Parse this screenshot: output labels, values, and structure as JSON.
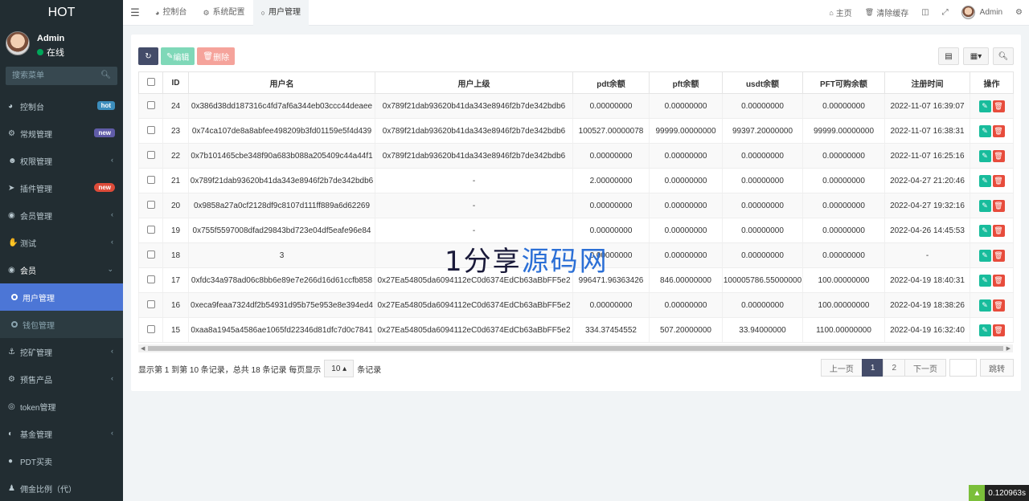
{
  "sidebar": {
    "logo": "HOT",
    "user": {
      "name": "Admin",
      "status": "在线"
    },
    "search_placeholder": "搜索菜单",
    "items": [
      {
        "label": "控制台",
        "icon": "dashboard-icon",
        "badge": "hot",
        "badge_color": "#3c8dbc"
      },
      {
        "label": "常规管理",
        "icon": "cogs-icon",
        "badge": "new",
        "badge_color": "#605ca8"
      },
      {
        "label": "权限管理",
        "icon": "users-icon",
        "chevron": "‹"
      },
      {
        "label": "插件管理",
        "icon": "rocket-icon",
        "badge": "new",
        "badge_color": "#dd4b39"
      },
      {
        "label": "会员管理",
        "icon": "user-circle-icon",
        "chevron": "‹"
      },
      {
        "label": "测试",
        "icon": "hand-icon",
        "chevron": "‹"
      },
      {
        "label": "会员",
        "icon": "user-circle-icon",
        "chevron": "⌄"
      },
      {
        "label": "用户管理",
        "sub": true,
        "active": true
      },
      {
        "label": "钱包管理",
        "sub": true
      },
      {
        "label": "挖矿管理",
        "icon": "anchor-icon",
        "chevron": "‹"
      },
      {
        "label": "预售产品",
        "icon": "cogs-icon",
        "chevron": "‹"
      },
      {
        "label": "token管理",
        "icon": "token-icon"
      },
      {
        "label": "基金管理",
        "icon": "adjust-icon",
        "chevron": "‹"
      },
      {
        "label": "PDT买卖",
        "icon": "globe-icon"
      },
      {
        "label": "佣金比例（代）",
        "icon": "child-icon"
      }
    ]
  },
  "topbar": {
    "tabs": [
      {
        "label": "控制台",
        "icon": "dashboard-icon"
      },
      {
        "label": "系统配置",
        "icon": "cog-icon"
      },
      {
        "label": "用户管理",
        "icon": "circle-icon",
        "active": true
      }
    ],
    "home": "主页",
    "clear_cache": "清除缓存",
    "admin": "Admin"
  },
  "toolbar": {
    "edit": "编辑",
    "delete": "删除"
  },
  "table": {
    "columns": [
      "ID",
      "用户名",
      "用户上级",
      "pdt余额",
      "pft余额",
      "usdt余额",
      "PFT可购余额",
      "注册时间",
      "操作"
    ],
    "rows": [
      [
        "24",
        "0x386d38dd187316c4fd7af6a344eb03ccc44deaee",
        "0x789f21dab93620b41da343e8946f2b7de342bdb6",
        "0.00000000",
        "0.00000000",
        "0.00000000",
        "0.00000000",
        "2022-11-07 16:39:07"
      ],
      [
        "23",
        "0x74ca107de8a8abfee498209b3fd01159e5f4d439",
        "0x789f21dab93620b41da343e8946f2b7de342bdb6",
        "100527.00000078",
        "99999.00000000",
        "99397.20000000",
        "99999.00000000",
        "2022-11-07 16:38:31"
      ],
      [
        "22",
        "0x7b101465cbe348f90a683b088a205409c44a44f1",
        "0x789f21dab93620b41da343e8946f2b7de342bdb6",
        "0.00000000",
        "0.00000000",
        "0.00000000",
        "0.00000000",
        "2022-11-07 16:25:16"
      ],
      [
        "21",
        "0x789f21dab93620b41da343e8946f2b7de342bdb6",
        "-",
        "2.00000000",
        "0.00000000",
        "0.00000000",
        "0.00000000",
        "2022-04-27 21:20:46"
      ],
      [
        "20",
        "0x9858a27a0cf2128df9c8107d111ff889a6d62269",
        "-",
        "0.00000000",
        "0.00000000",
        "0.00000000",
        "0.00000000",
        "2022-04-27 19:32:16"
      ],
      [
        "19",
        "0x755f5597008dfad29843bd723e04df5eafe96e84",
        "-",
        "0.00000000",
        "0.00000000",
        "0.00000000",
        "0.00000000",
        "2022-04-26 14:45:53"
      ],
      [
        "18",
        "3",
        "-",
        "0.00000000",
        "0.00000000",
        "0.00000000",
        "0.00000000",
        "-"
      ],
      [
        "17",
        "0xfdc34a978ad06c8bb6e89e7e266d16d61ccfb858",
        "0x27Ea54805da6094112eC0d6374EdCb63aBbFF5e2",
        "996471.96363426",
        "846.00000000",
        "100005786.55000000",
        "100.00000000",
        "2022-04-19 18:40:31"
      ],
      [
        "16",
        "0xeca9feaa7324df2b54931d95b75e953e8e394ed4",
        "0x27Ea54805da6094112eC0d6374EdCb63aBbFF5e2",
        "0.00000000",
        "0.00000000",
        "0.00000000",
        "100.00000000",
        "2022-04-19 18:38:26"
      ],
      [
        "15",
        "0xaa8a1945a4586ae1065fd22346d81dfc7d0c7841",
        "0x27Ea54805da6094112eC0d6374EdCb63aBbFF5e2",
        "334.37454552",
        "507.20000000",
        "33.94000000",
        "1100.00000000",
        "2022-04-19 16:32:40"
      ]
    ]
  },
  "pager": {
    "info_prefix": "显示第 1 到第 10 条记录，总共 18 条记录 每页显示",
    "page_size": "10",
    "info_suffix": "条记录",
    "prev": "上一页",
    "pages": [
      "1",
      "2"
    ],
    "next": "下一页",
    "go": "跳转"
  },
  "watermark": {
    "a": "1分享",
    "b": "源码网"
  },
  "timer": "0.120963s"
}
